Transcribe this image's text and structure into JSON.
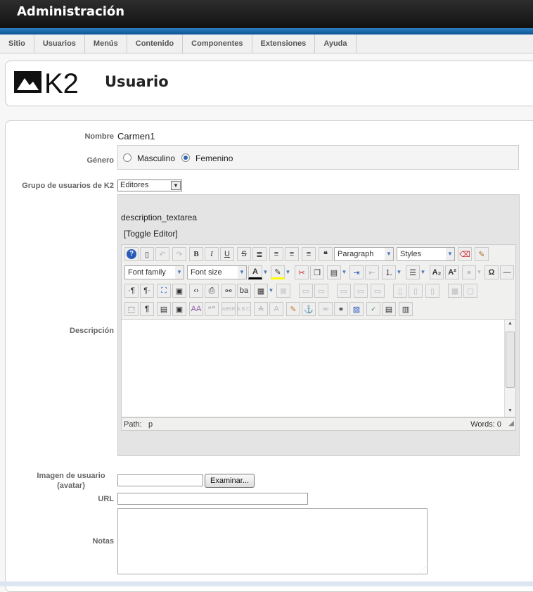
{
  "header": {
    "title": "Administración"
  },
  "menu": {
    "items": [
      "Sitio",
      "Usuarios",
      "Menús",
      "Contenido",
      "Componentes",
      "Extensiones",
      "Ayuda"
    ]
  },
  "page": {
    "logo": "K2",
    "title": "Usuario"
  },
  "form": {
    "nombre_label": "Nombre",
    "nombre_value": "Carmen1",
    "genero_label": "Género",
    "genero_options": [
      "Masculino",
      "Femenino"
    ],
    "genero_selected": "Femenino",
    "grupo_label": "Grupo de usuarios de K2",
    "grupo_value": "Editores",
    "descripcion_label": "Descripción",
    "imagen_label": "Imagen de usuario (avatar)",
    "browse_label": "Examinar...",
    "url_label": "URL",
    "url_value": "",
    "notas_label": "Notas",
    "notas_value": ""
  },
  "editor": {
    "textarea_name": "description_textarea",
    "toggle_label": "[Toggle Editor]",
    "format_dropdown": "Paragraph",
    "styles_dropdown": "Styles",
    "font_family": "Font family",
    "font_size": "Font size",
    "path_label": "Path:",
    "path_value": "p",
    "words_label": "Words: 0",
    "accent": "#4a79b8"
  }
}
